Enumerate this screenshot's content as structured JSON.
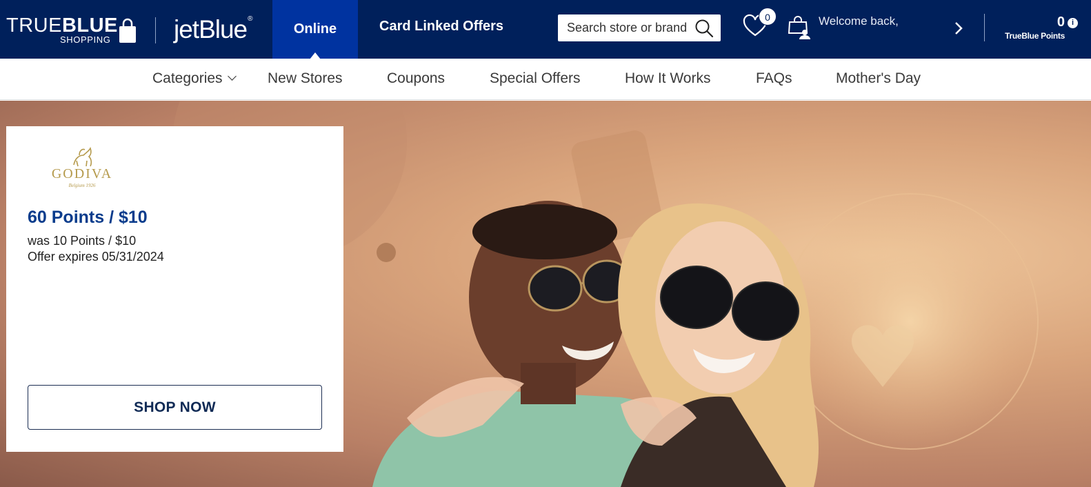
{
  "header": {
    "logo": {
      "word_light": "TRUE",
      "word_bold": "BLUE",
      "sub": "SHOPPING"
    },
    "partner_logo": "jetBlue",
    "partner_logo_mark": "®",
    "tabs": [
      {
        "label": "Online",
        "active": true
      },
      {
        "label": "Card Linked Offers",
        "active": false
      }
    ],
    "search": {
      "placeholder": "Search store or brand",
      "icon": "search-icon"
    },
    "favorites_count": "0",
    "welcome_text": "Welcome back,",
    "points_value": "0",
    "points_label": "TrueBlue Points",
    "points_info_glyph": "i",
    "colors": {
      "header_bg": "#00205b",
      "active_tab": "#0033a0"
    }
  },
  "nav": {
    "items": [
      {
        "label": "Categories",
        "has_dropdown": true
      },
      {
        "label": "New Stores"
      },
      {
        "label": "Coupons"
      },
      {
        "label": "Special Offers"
      },
      {
        "label": "How It Works"
      },
      {
        "label": "FAQs"
      },
      {
        "label": "Mother's Day"
      }
    ]
  },
  "hero": {
    "offer": {
      "brand_logo_text": "GODIVA",
      "brand_logo_sub": "Belgium 1926",
      "headline": "60 Points / $10",
      "was": "was 10 Points / $10",
      "expires": "Offer expires 05/31/2024",
      "cta": "SHOP NOW"
    },
    "colors": {
      "headline": "#0a3c8c"
    }
  }
}
